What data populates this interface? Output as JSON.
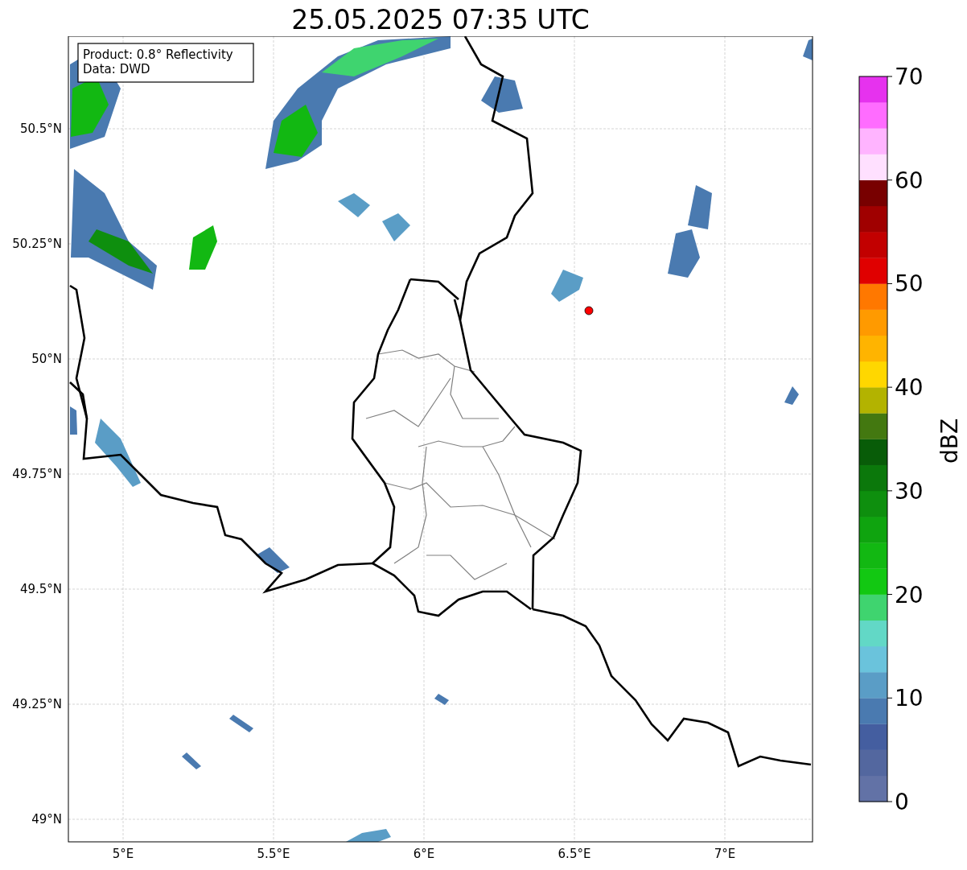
{
  "title": "25.05.2025 07:35 UTC",
  "map": {
    "info_lines": [
      "Product: 0.8° Reflectivity",
      "Data: DWD"
    ],
    "lat_ticks": [
      "50.5°N",
      "50.25°N",
      "50°N",
      "49.75°N",
      "49.5°N",
      "49.25°N",
      "49°N"
    ],
    "lon_ticks": [
      "5°E",
      "5.5°E",
      "6°E",
      "6.5°E",
      "7°E"
    ]
  },
  "colorbar": {
    "label": "dBZ",
    "ticks": [
      "70",
      "60",
      "50",
      "40",
      "30",
      "20",
      "10",
      "0"
    ],
    "bands": [
      {
        "color": "#6272a6"
      },
      {
        "color": "#53679f"
      },
      {
        "color": "#445ea0"
      },
      {
        "color": "#4a7ab0"
      },
      {
        "color": "#5a9dc6"
      },
      {
        "color": "#6ac3dc"
      },
      {
        "color": "#62d8c6"
      },
      {
        "color": "#3fd46f"
      },
      {
        "color": "#12c812"
      },
      {
        "color": "#12b812"
      },
      {
        "color": "#0fa40f"
      },
      {
        "color": "#0e8f0e"
      },
      {
        "color": "#0b780b"
      },
      {
        "color": "#085c08"
      },
      {
        "color": "#437810"
      },
      {
        "color": "#b3b300"
      },
      {
        "color": "#ffd700"
      },
      {
        "color": "#ffb400"
      },
      {
        "color": "#ff9a00"
      },
      {
        "color": "#ff7800"
      },
      {
        "color": "#e00000"
      },
      {
        "color": "#c20000"
      },
      {
        "color": "#a00000"
      },
      {
        "color": "#780000"
      },
      {
        "color": "#ffe0ff"
      },
      {
        "color": "#ffb4ff"
      },
      {
        "color": "#ff6cff"
      },
      {
        "color": "#e632ee"
      }
    ]
  }
}
